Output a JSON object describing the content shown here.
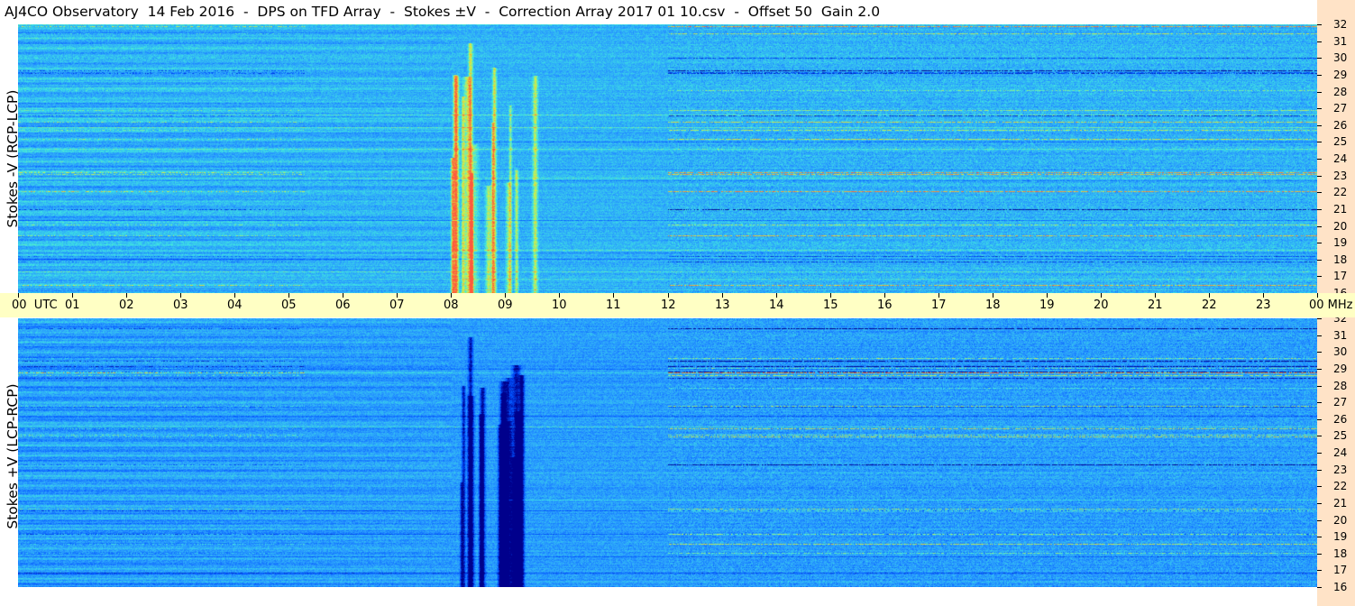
{
  "title": "AJ4CO Observatory  14 Feb 2016  -  DPS on TFD Array  -  Stokes ±V  -  Correction Array 2017 01 10.csv  -  Offset 50  Gain 2.0",
  "chart_data": {
    "type": "heatmap",
    "colormap": [
      "#00008c",
      "#0050ff",
      "#2a9dff",
      "#40e8e0",
      "#d8f040",
      "#ff5a3c"
    ],
    "background_color": "#1a66e6",
    "time_axis": {
      "labels": [
        "00  UTC",
        "01",
        "02",
        "03",
        "04",
        "05",
        "06",
        "07",
        "08",
        "09",
        "10",
        "11",
        "12",
        "13",
        "14",
        "15",
        "16",
        "17",
        "18",
        "19",
        "20",
        "21",
        "22",
        "23"
      ],
      "end_label": "00 MHz",
      "range_hours": [
        0,
        24
      ],
      "background": "#ffffc4"
    },
    "freq_axis": {
      "labels": [
        "32",
        "31",
        "30",
        "29",
        "28",
        "27",
        "26",
        "25",
        "24",
        "23",
        "22",
        "21",
        "20",
        "19",
        "18",
        "17",
        "16"
      ],
      "range_mhz": [
        16,
        32
      ],
      "unit": "MHz",
      "background": "#ffe3c7"
    },
    "panels": [
      {
        "ylabel": "Stokes -V (RCP-LCP)",
        "burst_polarity": "positive",
        "bursts_utc": [
          {
            "start_hour": 8.0,
            "end_hour": 9.6,
            "freq_range_mhz": [
              16,
              28
            ]
          }
        ],
        "active_period_utc": [
          12.0,
          24.0
        ]
      },
      {
        "ylabel": "Stokes +V (LCP-RCP)",
        "burst_polarity": "negative",
        "bursts_utc": [
          {
            "start_hour": 8.0,
            "end_hour": 9.6,
            "freq_range_mhz": [
              16,
              28
            ]
          }
        ],
        "active_period_utc": [
          12.0,
          24.0
        ]
      }
    ]
  }
}
